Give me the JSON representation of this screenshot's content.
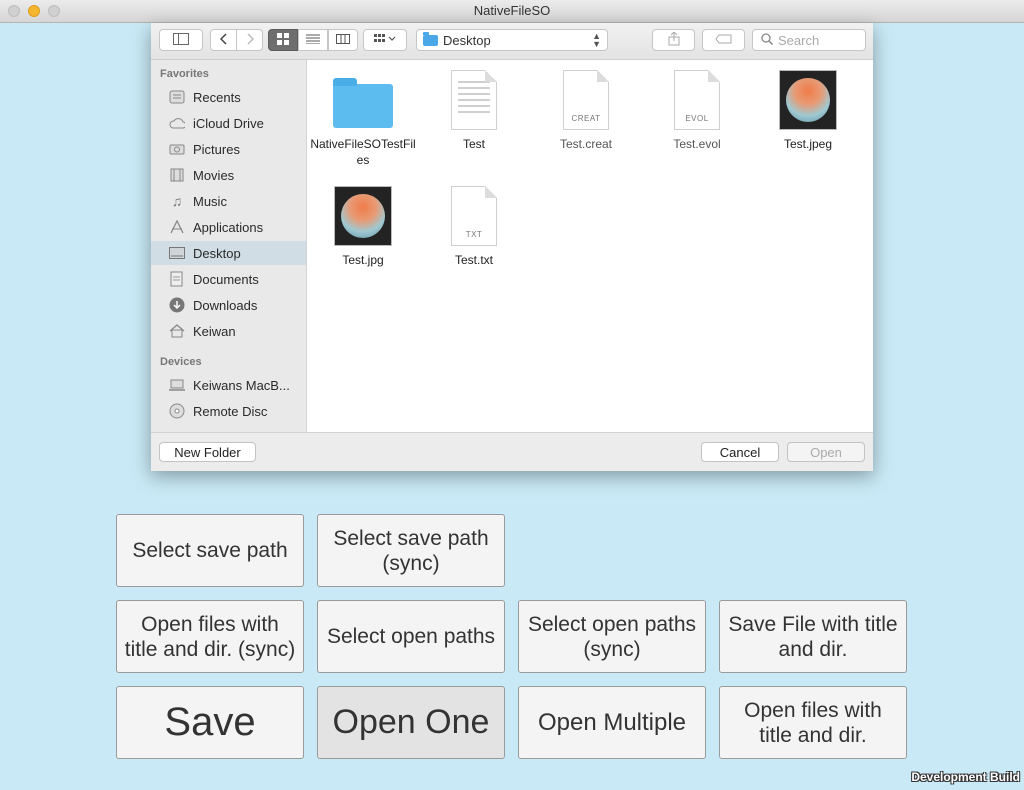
{
  "window": {
    "title": "NativeFileSO"
  },
  "dialog": {
    "location": "Desktop",
    "search_placeholder": "Search",
    "sidebar": {
      "favorites_heading": "Favorites",
      "favorites": [
        {
          "label": "Recents",
          "icon": "recents-icon"
        },
        {
          "label": "iCloud Drive",
          "icon": "cloud-icon"
        },
        {
          "label": "Pictures",
          "icon": "camera-icon"
        },
        {
          "label": "Movies",
          "icon": "film-icon"
        },
        {
          "label": "Music",
          "icon": "music-note-icon"
        },
        {
          "label": "Applications",
          "icon": "applications-icon"
        },
        {
          "label": "Desktop",
          "icon": "desktop-icon",
          "selected": true
        },
        {
          "label": "Documents",
          "icon": "documents-icon"
        },
        {
          "label": "Downloads",
          "icon": "download-icon"
        },
        {
          "label": "Keiwan",
          "icon": "home-icon"
        }
      ],
      "devices_heading": "Devices",
      "devices": [
        {
          "label": "Keiwans MacB...",
          "icon": "laptop-icon"
        },
        {
          "label": "Remote Disc",
          "icon": "disc-icon"
        }
      ]
    },
    "files": [
      {
        "name": "NativeFileSOTestFiles",
        "kind": "folder"
      },
      {
        "name": "Test",
        "kind": "document"
      },
      {
        "name": "Test.creat",
        "kind": "generic",
        "ext": "CREAT",
        "dimmed": true
      },
      {
        "name": "Test.evol",
        "kind": "generic",
        "ext": "EVOL",
        "dimmed": true
      },
      {
        "name": "Test.jpeg",
        "kind": "image"
      },
      {
        "name": "Test.jpg",
        "kind": "image"
      },
      {
        "name": "Test.txt",
        "kind": "text",
        "ext": "TXT"
      }
    ],
    "footer": {
      "new_folder": "New Folder",
      "cancel": "Cancel",
      "open": "Open"
    }
  },
  "buttons": {
    "select_save_path": "Select save path",
    "select_save_path_sync": "Select save path (sync)",
    "open_files_title_dir_sync": "Open files with title and dir. (sync)",
    "select_open_paths": "Select open paths",
    "select_open_paths_sync": "Select open paths (sync)",
    "save_file_title_dir": "Save File with title and dir.",
    "save": "Save",
    "open_one": "Open One",
    "open_multiple": "Open Multiple",
    "open_files_title_dir": "Open files with title and dir."
  },
  "footer_badge": "Development Build"
}
